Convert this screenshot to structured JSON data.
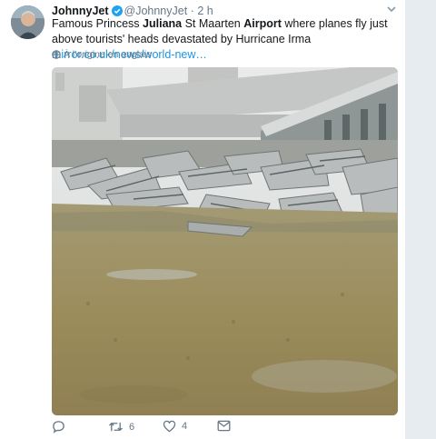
{
  "tweet": {
    "author_name": "JohnnyJet",
    "author_handle": "@JohnnyJet",
    "separator": "·",
    "time": "2 h",
    "text_parts": {
      "p1": "Famous Princess ",
      "p2": "Juliana",
      "p3": " St Maarten ",
      "p4": "Airport",
      "p5": " where planes fly just above tourists' heads devastated by Hurricane Irma ",
      "link": "mirror.co.uk/news/world-new…"
    },
    "translate_label": "À l'origine en anglais",
    "media_icon": "hurricane-debris-photo"
  },
  "actions": {
    "reply_count": "",
    "retweet_count": "6",
    "like_count": "4"
  },
  "colors": {
    "link": "#1b95e0",
    "verified": "#1da1f2",
    "muted": "#657786"
  }
}
